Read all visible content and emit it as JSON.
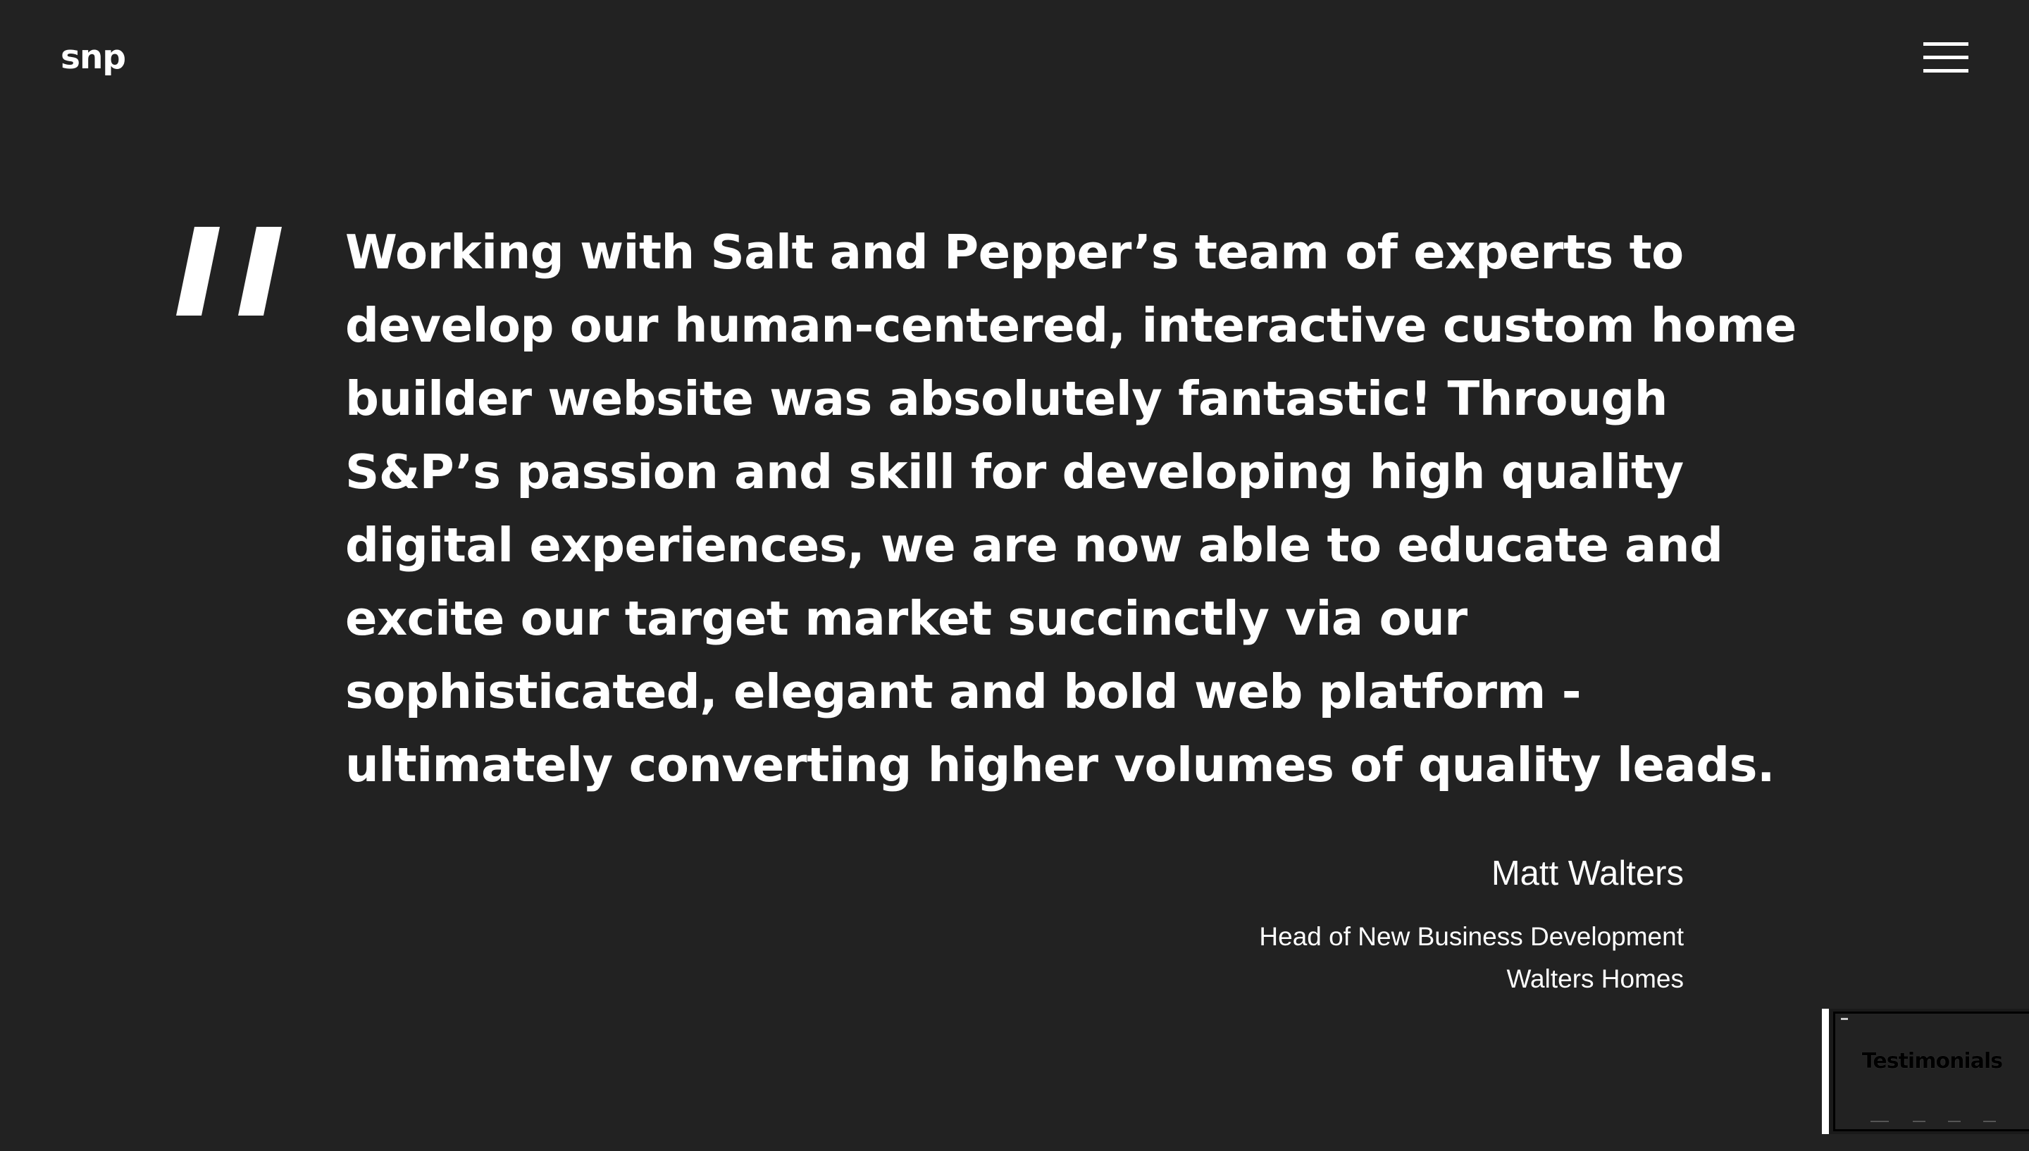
{
  "header": {
    "logo_text": "snp",
    "menu_icon": "hamburger-menu-icon"
  },
  "testimonial": {
    "quote_icon": "quotation-mark-icon",
    "quote_lines": [
      "Working with Salt and Pepper’s team of experts to",
      "develop our human-centered, interactive custom home",
      "builder website was absolutely fantastic! Through",
      "S&P’s passion and skill for developing high quality",
      "digital experiences, we are now able to educate and",
      "excite our target market succinctly via our",
      "sophisticated, elegant and bold web platform -",
      "ultimately converting higher volumes of quality leads."
    ],
    "author_name": "Matt Walters",
    "author_role": "Head of New Business Development",
    "author_company": "Walters Homes"
  },
  "thumbnail": {
    "title": "Testimonials"
  },
  "colors": {
    "background": "#222222",
    "text": "#ffffff"
  }
}
